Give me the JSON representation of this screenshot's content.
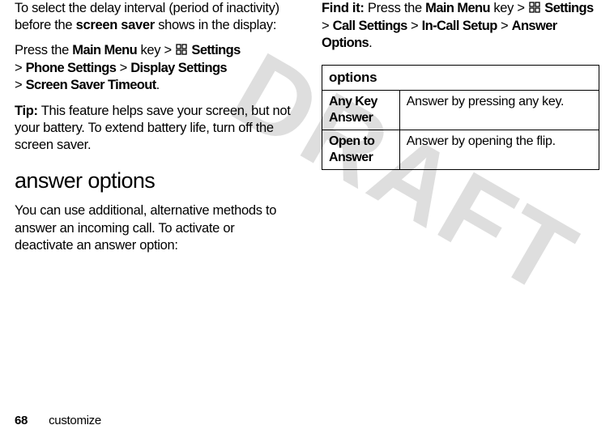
{
  "watermark": "DRAFT",
  "left": {
    "intro_a": "To select the delay interval (period of inactivity) before the ",
    "intro_b": "screen saver",
    "intro_c": " shows in the display:",
    "press_a": "Press the ",
    "mainmenu": "Main Menu",
    "press_b": " key > ",
    "settings": "Settings",
    "gt": "> ",
    "phone_settings": "Phone Settings",
    "sep": " > ",
    "display_settings": "Display Settings",
    "sst": "Screen Saver Timeout",
    "period": ".",
    "tip_label": "Tip:",
    "tip_body": " This feature helps save your screen, but not your battery. To extend battery life, turn off the screen saver.",
    "h2": "answer options",
    "body2": "You can use additional, alternative methods to answer an incoming call. To activate or deactivate an answer option:"
  },
  "right": {
    "findit": "Find it:",
    "press_a": " Press the ",
    "mainmenu": "Main Menu",
    "press_b": " key > ",
    "settings": "Settings",
    "gt": "> ",
    "call_settings": "Call Settings",
    "sep": " > ",
    "incall": "In-Call Setup",
    "answer_options": "Answer Options",
    "period": ".",
    "table": {
      "header": "options",
      "rows": [
        {
          "name": "Any Key Answer",
          "desc": "Answer by pressing any key."
        },
        {
          "name": "Open to Answer",
          "desc": "Answer by opening the flip."
        }
      ]
    }
  },
  "footer": {
    "page": "68",
    "section": "customize"
  },
  "icon_name": "settings-icon"
}
